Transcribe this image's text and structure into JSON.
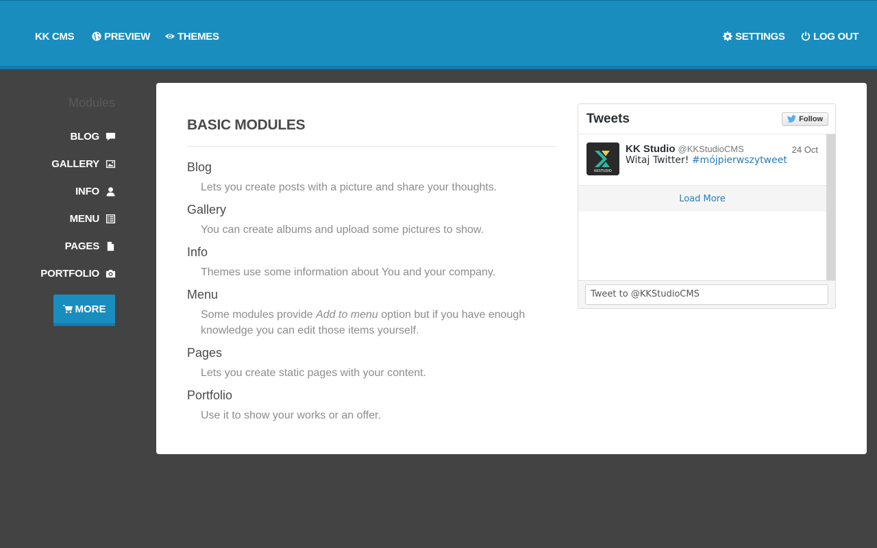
{
  "topnav": {
    "brand": "KK CMS",
    "preview": "PREVIEW",
    "themes": "THEMES",
    "settings": "SETTINGS",
    "logout": "LOG OUT"
  },
  "sidebar": {
    "heading": "Modules",
    "items": [
      {
        "label": "BLOG",
        "icon": "comment-icon"
      },
      {
        "label": "GALLERY",
        "icon": "picture-icon"
      },
      {
        "label": "INFO",
        "icon": "user-icon"
      },
      {
        "label": "MENU",
        "icon": "list-icon"
      },
      {
        "label": "PAGES",
        "icon": "file-icon"
      },
      {
        "label": "PORTFOLIO",
        "icon": "camera-icon"
      }
    ],
    "more_button": "MORE"
  },
  "main": {
    "title": "BASIC MODULES",
    "modules": [
      {
        "name": "Blog",
        "desc": "Lets you create posts with a picture and share your thoughts."
      },
      {
        "name": "Gallery",
        "desc": "You can create albums and upload some pictures to show."
      },
      {
        "name": "Info",
        "desc": "Themes use some information about You and your company."
      },
      {
        "name": "Menu",
        "desc_before": "Some modules provide ",
        "desc_em": "Add to menu",
        "desc_after": " option but if you have enough knowledge you can edit those items yourself."
      },
      {
        "name": "Pages",
        "desc": "Lets you create static pages with your content."
      },
      {
        "name": "Portfolio",
        "desc": "Use it to show your works or an offer."
      }
    ]
  },
  "tweets": {
    "title": "Tweets",
    "follow_label": "Follow",
    "tweet": {
      "author": "KK Studio",
      "handle": "@KKStudioCMS",
      "date": "24 Oct",
      "text": "Witaj Twitter! ",
      "hashtag": "#mójpierwszytweet",
      "avatar_text": "KKSTUDIO"
    },
    "load_more": "Load More",
    "input_placeholder": "Tweet to @KKStudioCMS"
  },
  "colors": {
    "header_blue": "#1a8dbf",
    "background": "#434343",
    "link_blue": "#2b7bb9"
  }
}
